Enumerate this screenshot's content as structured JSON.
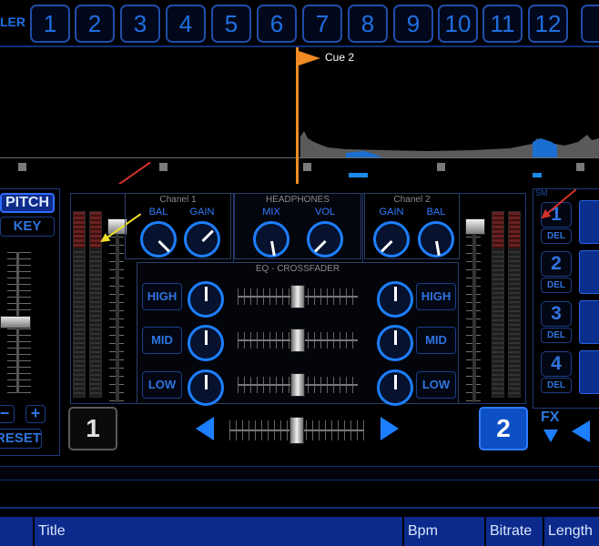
{
  "topbar": {
    "label": "LER",
    "cue_buttons": [
      "1",
      "2",
      "3",
      "4",
      "5",
      "6",
      "7",
      "8",
      "9",
      "10",
      "11",
      "12"
    ]
  },
  "waveform": {
    "cue_flag_label": "Cue 2",
    "colors": {
      "flag": "#f08a24",
      "marker": "#1a8bea"
    }
  },
  "left_deck": {
    "pitch_label": "PITCH",
    "key_label": "KEY",
    "minus_label": "−",
    "plus_label": "+",
    "reset_label": "RESET",
    "deck_number": "1"
  },
  "channel1": {
    "title": "Chanel 1",
    "bal_label": "BAL",
    "gain_label": "GAIN"
  },
  "headphones": {
    "title": "HEADPHONES",
    "mix_label": "MIX",
    "vol_label": "VOL"
  },
  "channel2": {
    "title": "Chanel 2",
    "gain_label": "GAIN",
    "bal_label": "BAL"
  },
  "eq": {
    "title": "EQ - CROSSFADER",
    "left": [
      "HIGH",
      "MID",
      "LOW"
    ],
    "right": [
      "HIGH",
      "MID",
      "LOW"
    ]
  },
  "right_deck": {
    "deck_number": "2"
  },
  "sampler": {
    "label": "SM",
    "slots": [
      {
        "num": "1",
        "del": "DEL"
      },
      {
        "num": "2",
        "del": "DEL"
      },
      {
        "num": "3",
        "del": "DEL"
      },
      {
        "num": "4",
        "del": "DEL"
      }
    ],
    "fx_label": "FX"
  },
  "playlist": {
    "columns": [
      "",
      "Title",
      "Bpm",
      "Bitrate",
      "Length"
    ]
  },
  "theme": {
    "accent": "#1d7fff",
    "panel_border": "#1b3e8a",
    "header_bg": "#0b2a8c"
  }
}
